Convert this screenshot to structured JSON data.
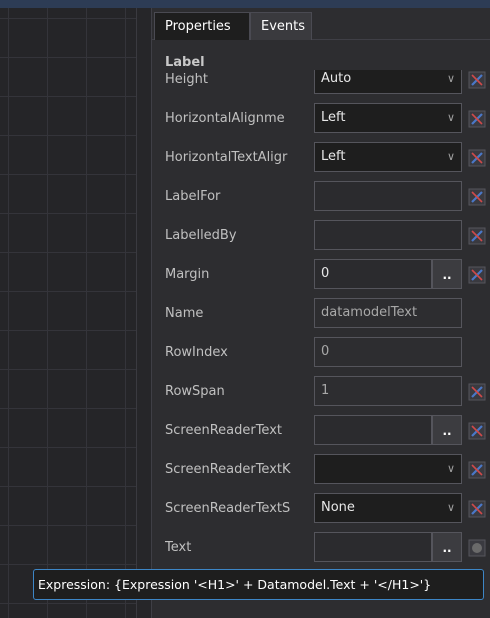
{
  "tabs": [
    {
      "label": "Properties",
      "active": true
    },
    {
      "label": "Events",
      "active": false
    }
  ],
  "section_title": "Label",
  "properties": [
    {
      "name": "Height",
      "value": "Auto",
      "kind": "dropdown",
      "reset": true
    },
    {
      "name": "HorizontalAlignme",
      "value": "Left",
      "kind": "dropdown",
      "reset": true
    },
    {
      "name": "HorizontalTextAligr",
      "value": "Left",
      "kind": "dropdown",
      "reset": true
    },
    {
      "name": "LabelFor",
      "value": "",
      "kind": "text",
      "reset": true
    },
    {
      "name": "LabelledBy",
      "value": "",
      "kind": "text",
      "reset": true
    },
    {
      "name": "Margin",
      "value": "0",
      "kind": "ellipsis",
      "reset": true
    },
    {
      "name": "Name",
      "value": "datamodelText",
      "kind": "readonly",
      "reset": false
    },
    {
      "name": "RowIndex",
      "value": "0",
      "kind": "readonly",
      "reset": false
    },
    {
      "name": "RowSpan",
      "value": "1",
      "kind": "readonly",
      "reset": true
    },
    {
      "name": "ScreenReaderText",
      "value": "",
      "kind": "ellipsis",
      "reset": true
    },
    {
      "name": "ScreenReaderTextK",
      "value": "",
      "kind": "dropdown",
      "reset": true
    },
    {
      "name": "ScreenReaderTextS",
      "value": "None",
      "kind": "dropdown",
      "reset": true
    },
    {
      "name": "Text",
      "value": "",
      "kind": "ellipsis",
      "reset": true,
      "reset_disabled": true
    }
  ],
  "tooltip": "Expression: {Expression '<H1>' + Datamodel.Text + '</H1>'}",
  "icons": {
    "dropdown": "chevron-down-icon",
    "reset": "reset-to-default-icon",
    "ellipsis": "ellipsis-icon"
  },
  "colors": {
    "panel_bg": "#2d2d30",
    "field_border": "#55555c",
    "tooltip_border": "#3d86c6",
    "reset_icon_blue": "#4a78c8",
    "reset_icon_red": "#d04a4a"
  },
  "ellipsis_label": ".."
}
